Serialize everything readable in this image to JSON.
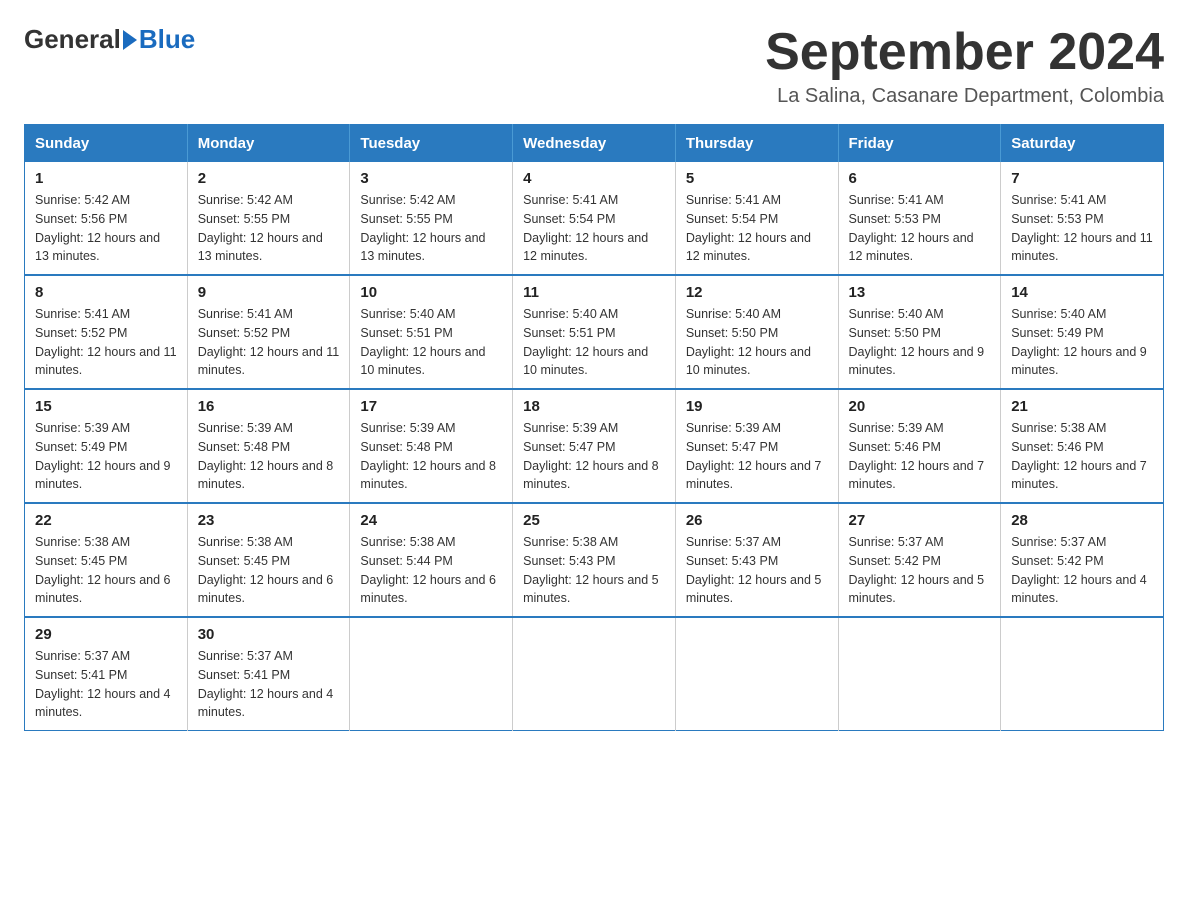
{
  "logo": {
    "general": "General",
    "blue": "Blue"
  },
  "title": "September 2024",
  "location": "La Salina, Casanare Department, Colombia",
  "weekdays": [
    "Sunday",
    "Monday",
    "Tuesday",
    "Wednesday",
    "Thursday",
    "Friday",
    "Saturday"
  ],
  "weeks": [
    [
      {
        "day": "1",
        "sunrise": "5:42 AM",
        "sunset": "5:56 PM",
        "daylight": "12 hours and 13 minutes."
      },
      {
        "day": "2",
        "sunrise": "5:42 AM",
        "sunset": "5:55 PM",
        "daylight": "12 hours and 13 minutes."
      },
      {
        "day": "3",
        "sunrise": "5:42 AM",
        "sunset": "5:55 PM",
        "daylight": "12 hours and 13 minutes."
      },
      {
        "day": "4",
        "sunrise": "5:41 AM",
        "sunset": "5:54 PM",
        "daylight": "12 hours and 12 minutes."
      },
      {
        "day": "5",
        "sunrise": "5:41 AM",
        "sunset": "5:54 PM",
        "daylight": "12 hours and 12 minutes."
      },
      {
        "day": "6",
        "sunrise": "5:41 AM",
        "sunset": "5:53 PM",
        "daylight": "12 hours and 12 minutes."
      },
      {
        "day": "7",
        "sunrise": "5:41 AM",
        "sunset": "5:53 PM",
        "daylight": "12 hours and 11 minutes."
      }
    ],
    [
      {
        "day": "8",
        "sunrise": "5:41 AM",
        "sunset": "5:52 PM",
        "daylight": "12 hours and 11 minutes."
      },
      {
        "day": "9",
        "sunrise": "5:41 AM",
        "sunset": "5:52 PM",
        "daylight": "12 hours and 11 minutes."
      },
      {
        "day": "10",
        "sunrise": "5:40 AM",
        "sunset": "5:51 PM",
        "daylight": "12 hours and 10 minutes."
      },
      {
        "day": "11",
        "sunrise": "5:40 AM",
        "sunset": "5:51 PM",
        "daylight": "12 hours and 10 minutes."
      },
      {
        "day": "12",
        "sunrise": "5:40 AM",
        "sunset": "5:50 PM",
        "daylight": "12 hours and 10 minutes."
      },
      {
        "day": "13",
        "sunrise": "5:40 AM",
        "sunset": "5:50 PM",
        "daylight": "12 hours and 9 minutes."
      },
      {
        "day": "14",
        "sunrise": "5:40 AM",
        "sunset": "5:49 PM",
        "daylight": "12 hours and 9 minutes."
      }
    ],
    [
      {
        "day": "15",
        "sunrise": "5:39 AM",
        "sunset": "5:49 PM",
        "daylight": "12 hours and 9 minutes."
      },
      {
        "day": "16",
        "sunrise": "5:39 AM",
        "sunset": "5:48 PM",
        "daylight": "12 hours and 8 minutes."
      },
      {
        "day": "17",
        "sunrise": "5:39 AM",
        "sunset": "5:48 PM",
        "daylight": "12 hours and 8 minutes."
      },
      {
        "day": "18",
        "sunrise": "5:39 AM",
        "sunset": "5:47 PM",
        "daylight": "12 hours and 8 minutes."
      },
      {
        "day": "19",
        "sunrise": "5:39 AM",
        "sunset": "5:47 PM",
        "daylight": "12 hours and 7 minutes."
      },
      {
        "day": "20",
        "sunrise": "5:39 AM",
        "sunset": "5:46 PM",
        "daylight": "12 hours and 7 minutes."
      },
      {
        "day": "21",
        "sunrise": "5:38 AM",
        "sunset": "5:46 PM",
        "daylight": "12 hours and 7 minutes."
      }
    ],
    [
      {
        "day": "22",
        "sunrise": "5:38 AM",
        "sunset": "5:45 PM",
        "daylight": "12 hours and 6 minutes."
      },
      {
        "day": "23",
        "sunrise": "5:38 AM",
        "sunset": "5:45 PM",
        "daylight": "12 hours and 6 minutes."
      },
      {
        "day": "24",
        "sunrise": "5:38 AM",
        "sunset": "5:44 PM",
        "daylight": "12 hours and 6 minutes."
      },
      {
        "day": "25",
        "sunrise": "5:38 AM",
        "sunset": "5:43 PM",
        "daylight": "12 hours and 5 minutes."
      },
      {
        "day": "26",
        "sunrise": "5:37 AM",
        "sunset": "5:43 PM",
        "daylight": "12 hours and 5 minutes."
      },
      {
        "day": "27",
        "sunrise": "5:37 AM",
        "sunset": "5:42 PM",
        "daylight": "12 hours and 5 minutes."
      },
      {
        "day": "28",
        "sunrise": "5:37 AM",
        "sunset": "5:42 PM",
        "daylight": "12 hours and 4 minutes."
      }
    ],
    [
      {
        "day": "29",
        "sunrise": "5:37 AM",
        "sunset": "5:41 PM",
        "daylight": "12 hours and 4 minutes."
      },
      {
        "day": "30",
        "sunrise": "5:37 AM",
        "sunset": "5:41 PM",
        "daylight": "12 hours and 4 minutes."
      },
      null,
      null,
      null,
      null,
      null
    ]
  ]
}
